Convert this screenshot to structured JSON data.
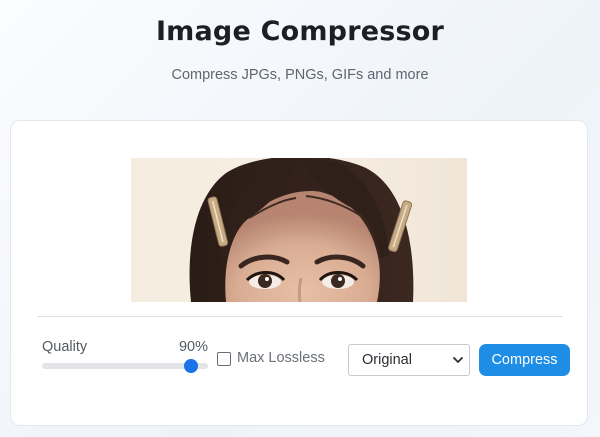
{
  "header": {
    "title": "Image Compressor",
    "subtitle": "Compress JPGs, PNGs, GIFs and more"
  },
  "controls": {
    "quality_label": "Quality",
    "quality_value_text": "90%",
    "quality_level": 0.9,
    "lossless_label": "Max Lossless",
    "lossless_checked": false,
    "format_selected": "Original",
    "compress_label": "Compress"
  },
  "colors": {
    "accent": "#1a73e8",
    "button": "#1e8de6"
  },
  "preview": {
    "icon": "photo-preview"
  }
}
